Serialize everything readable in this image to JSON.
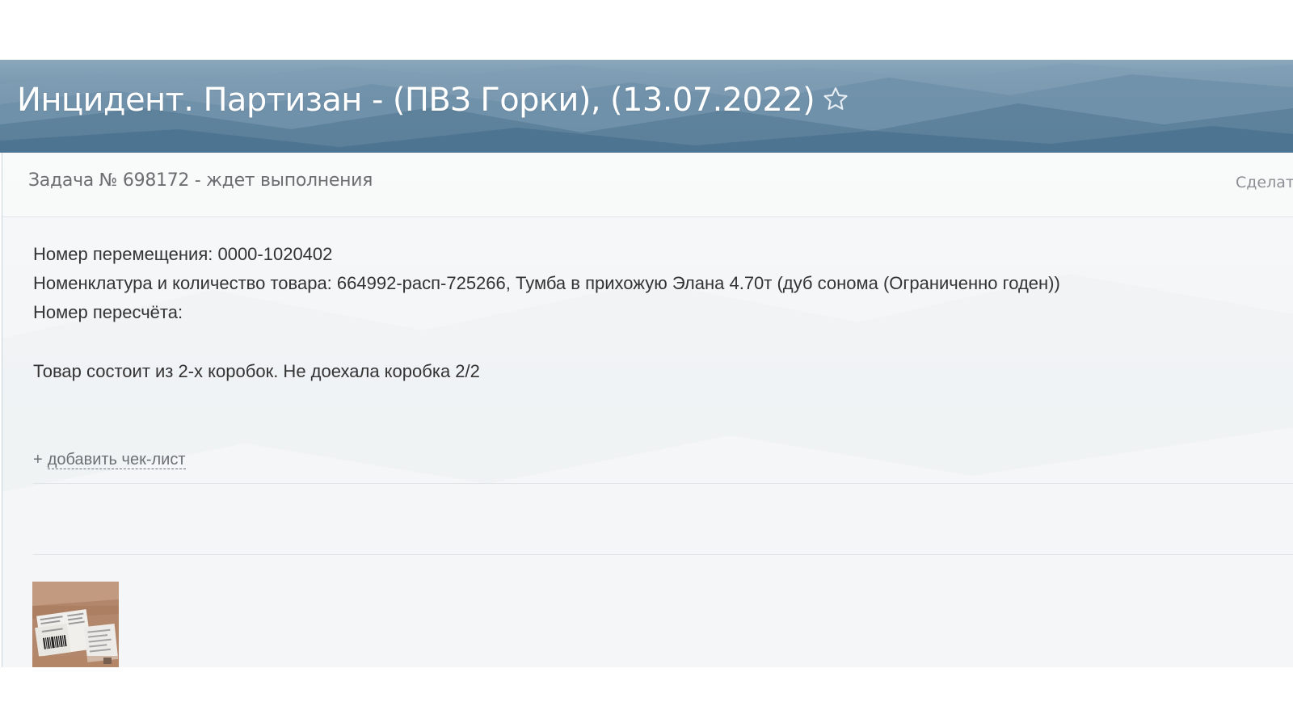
{
  "header": {
    "title": "Инцидент. Партизан - (ПВЗ Горки), (13.07.2022)",
    "star_icon": "star-outline-icon"
  },
  "task": {
    "title": "Задача № 698172 - ждет выполнения",
    "action_label": "Сделат"
  },
  "description": {
    "lines": [
      "Номер перемещения: 0000-1020402",
      "Номенклатура и количество товара: 664992-расп-725266, Тумба в прихожую Элана 4.70т (дуб сонома (Ограниченно годен))",
      "Номер пересчёта:",
      "Товар состоит из 2-х коробок. Не доехала коробка 2/2"
    ]
  },
  "checklist": {
    "plus": "+",
    "add_label": "добавить чек-лист"
  },
  "attachments": [
    {
      "type": "image",
      "name": "photo-attachment-thumbnail"
    }
  ],
  "colors": {
    "header_top": "#8aa7bb",
    "header_bottom": "#557a95",
    "title_text": "#ffffff",
    "body_text": "#333333",
    "muted_text": "#6c6f72"
  }
}
